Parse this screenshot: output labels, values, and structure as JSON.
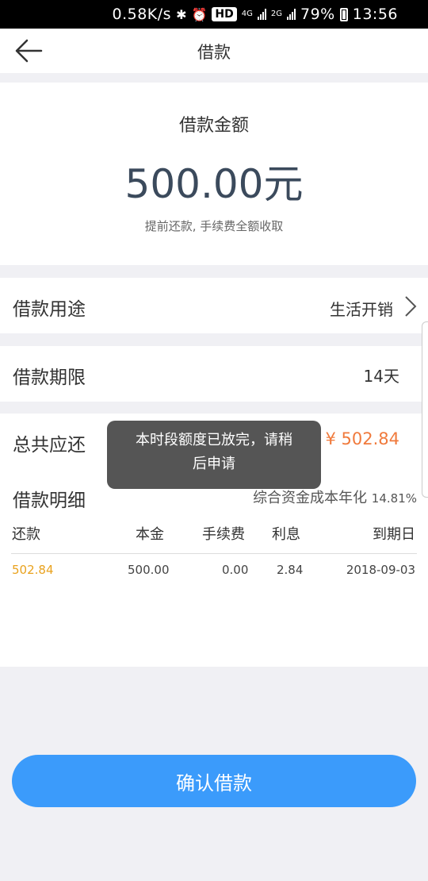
{
  "status_bar": {
    "speed": "0.58K/s",
    "hd": "HD",
    "net_4g": "4G",
    "net_2g": "2G",
    "battery": "79%",
    "time": "13:56",
    "icons": [
      "bluetooth-icon",
      "alarm-icon",
      "signal-icon",
      "battery-icon"
    ]
  },
  "nav": {
    "title": "借款",
    "back_icon": "back-arrow-icon"
  },
  "amount": {
    "label": "借款金额",
    "value": "500.00元",
    "note": "提前还款, 手续费全额收取"
  },
  "purpose": {
    "label": "借款用途",
    "value": "生活开销",
    "icon": "chevron-right-icon"
  },
  "term": {
    "label": "借款期限",
    "value": "14天"
  },
  "total": {
    "label": "总共应还",
    "value": "¥ 502.84"
  },
  "detail": {
    "label": "借款明细",
    "annual_label": "综合资金成本年化",
    "annual_rate": "14.81%",
    "columns": [
      "还款",
      "本金",
      "手续费",
      "利息",
      "到期日"
    ],
    "rows": [
      {
        "repay": "502.84",
        "principal": "500.00",
        "fee": "0.00",
        "interest": "2.84",
        "due": "2018-09-03"
      }
    ]
  },
  "toast": {
    "line1": "本时段额度已放完，请稍",
    "line2": "后申请"
  },
  "confirm_button": "确认借款",
  "colors": {
    "accent_blue": "#3b9bfb",
    "orange": "#f07a3c",
    "gold": "#e9a21e"
  }
}
